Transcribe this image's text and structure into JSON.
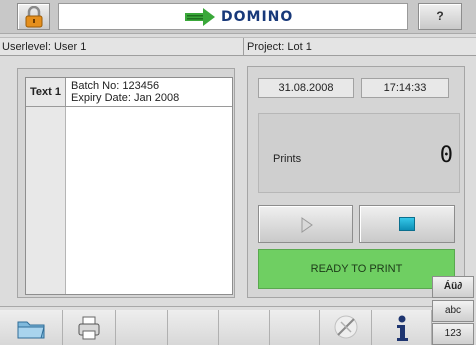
{
  "header": {
    "logo_text": "DOMINO",
    "help_label": "?",
    "colors": {
      "logo_blue": "#18397a",
      "logo_green": "#3aa83a"
    }
  },
  "info": {
    "userlevel": "Userlevel: User 1",
    "project": "Project: Lot 1"
  },
  "message": {
    "label": "Text 1",
    "line1": "Batch No: 123456",
    "line2": "Expiry Date: Jan 2008"
  },
  "status": {
    "date": "31.08.2008",
    "time": "17:14:33",
    "prints_label": "Prints",
    "prints_value": "0",
    "ready_text": "READY TO PRINT",
    "ready_color": "#6fcf62"
  },
  "keyboard_buttons": {
    "special": "Áü∂",
    "lower": "abc",
    "numeric": "123"
  },
  "icons": {
    "lock": "padlock-icon",
    "open": "folder-open-icon",
    "print": "printer-icon",
    "scissors": "tools-icon",
    "info": "info-icon",
    "play": "play-icon",
    "stop": "stop-icon"
  }
}
